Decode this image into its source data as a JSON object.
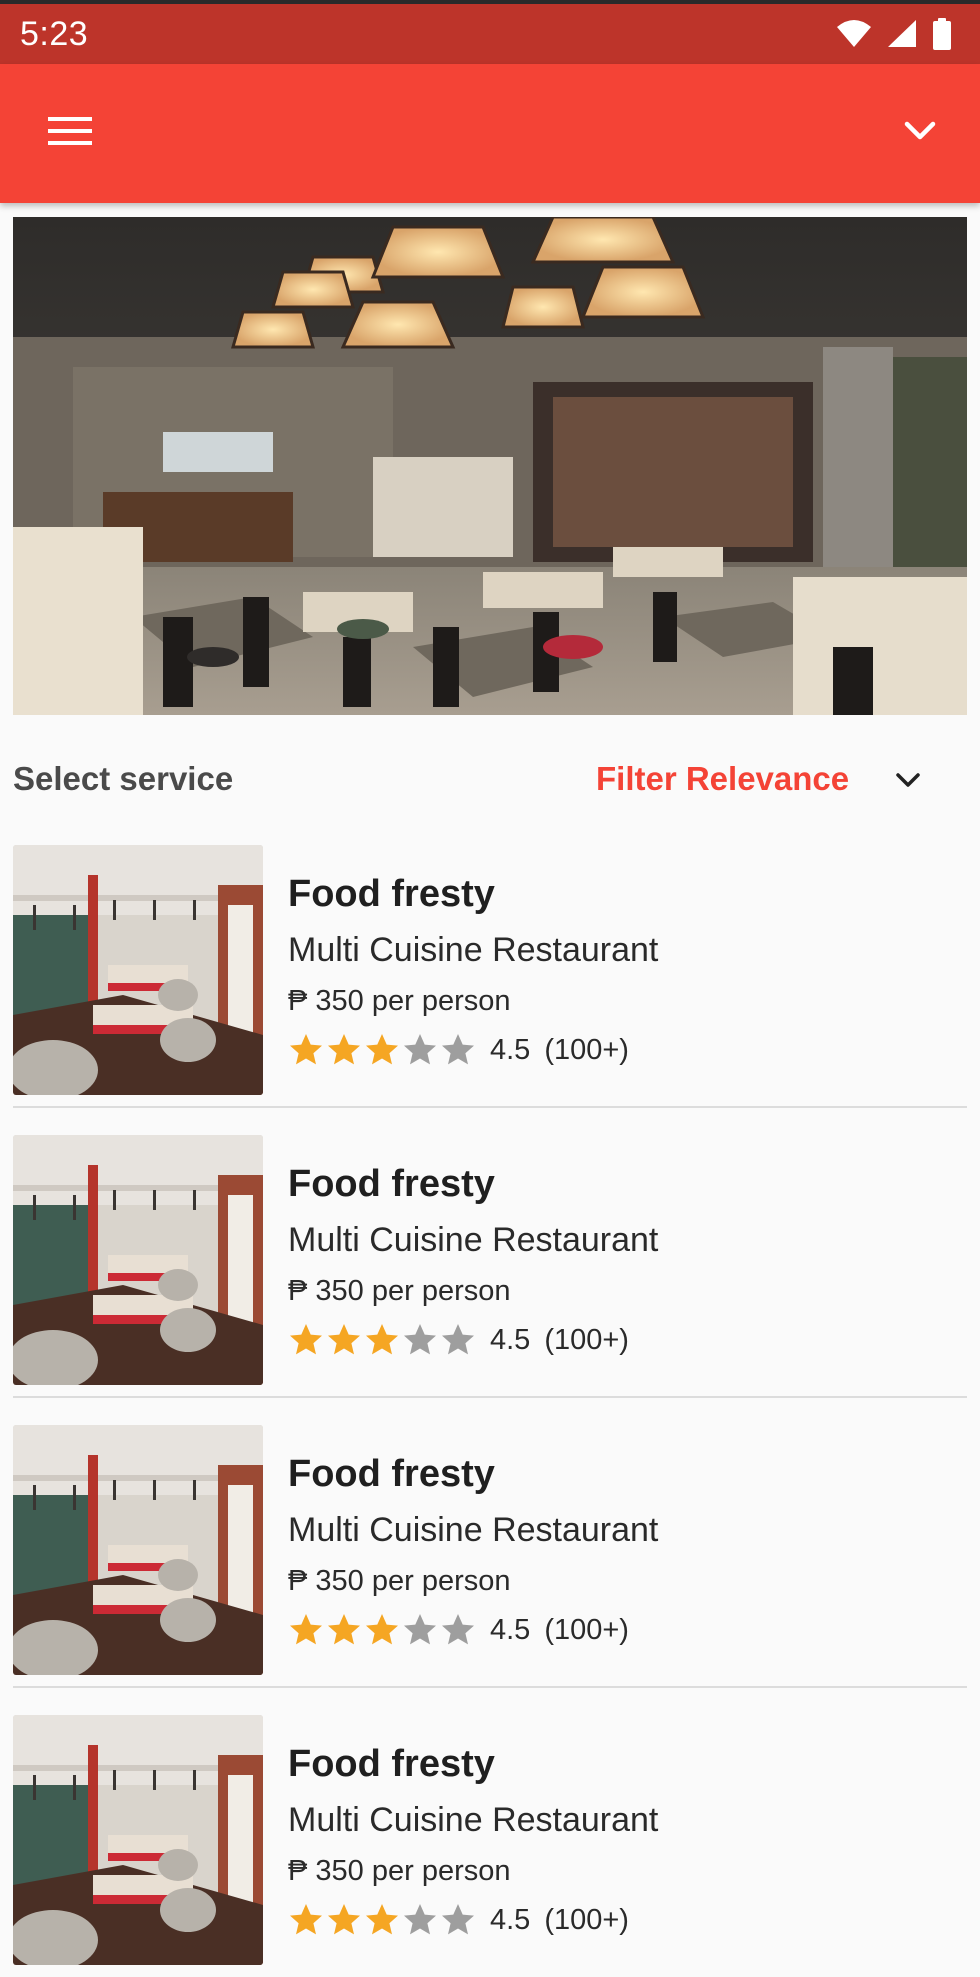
{
  "status_bar": {
    "time": "5:23",
    "icons": [
      "wifi-icon",
      "signal-icon",
      "battery-icon"
    ]
  },
  "app_bar": {
    "menu_icon": "hamburger-menu-icon",
    "dropdown_icon": "chevron-down-icon",
    "color": "#f44336"
  },
  "hero": {
    "image": "restaurant-interior-photo"
  },
  "filter": {
    "select_service": "Select service",
    "filter_label": "Filter Relevance",
    "dropdown_icon": "chevron-down-icon"
  },
  "restaurants": [
    {
      "name": "Food fresty",
      "cuisine": "Multi Cuisine Restaurant",
      "price": "₱ 350 per person",
      "stars_filled": 3,
      "stars_total": 5,
      "rating": "4.5",
      "reviews": "(100+)"
    },
    {
      "name": "Food fresty",
      "cuisine": "Multi Cuisine Restaurant",
      "price": "₱ 350 per person",
      "stars_filled": 3,
      "stars_total": 5,
      "rating": "4.5",
      "reviews": "(100+)"
    },
    {
      "name": "Food fresty",
      "cuisine": "Multi Cuisine Restaurant",
      "price": "₱ 350 per person",
      "stars_filled": 3,
      "stars_total": 5,
      "rating": "4.5",
      "reviews": "(100+)"
    },
    {
      "name": "Food fresty",
      "cuisine": "Multi Cuisine Restaurant",
      "price": "₱ 350 per person",
      "stars_filled": 3,
      "stars_total": 5,
      "rating": "4.5",
      "reviews": "(100+)"
    }
  ],
  "colors": {
    "accent": "#f44336",
    "status_bar": "#bd342a",
    "star_filled": "#f5a623",
    "star_empty": "#9e9e9e"
  }
}
